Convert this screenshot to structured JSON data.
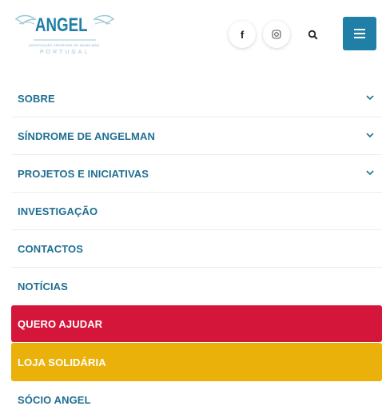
{
  "header": {
    "logo": {
      "name": "ANGEL",
      "tagline": "ASSOCIAÇÃO SÍNDROME DE ANGELMAN",
      "country": "PORTUGAL"
    },
    "social": [
      {
        "icon": "facebook-icon",
        "glyph": "f"
      },
      {
        "icon": "instagram-icon",
        "glyph": "◎"
      }
    ],
    "search_icon": "search-icon",
    "menu_icon": "hamburger-menu-icon"
  },
  "nav": {
    "items": [
      {
        "label": "SOBRE",
        "has_submenu": true
      },
      {
        "label": "SÍNDROME DE ANGELMAN",
        "has_submenu": true
      },
      {
        "label": "PROJETOS E INICIATIVAS",
        "has_submenu": true
      },
      {
        "label": "INVESTIGAÇÃO",
        "has_submenu": false
      },
      {
        "label": "CONTACTOS",
        "has_submenu": false
      },
      {
        "label": "NOTÍCIAS",
        "has_submenu": false
      },
      {
        "label": "QUERO AJUDAR",
        "has_submenu": false,
        "highlight": "red"
      },
      {
        "label": "LOJA SOLIDÁRIA",
        "has_submenu": false,
        "highlight": "yellow"
      },
      {
        "label": "SÓCIO ANGEL",
        "has_submenu": false
      }
    ]
  },
  "colors": {
    "brand_blue": "#1f7fa6",
    "nav_text": "#1f6f93",
    "highlight_red": "#d4163b",
    "highlight_yellow": "#eab10a"
  }
}
